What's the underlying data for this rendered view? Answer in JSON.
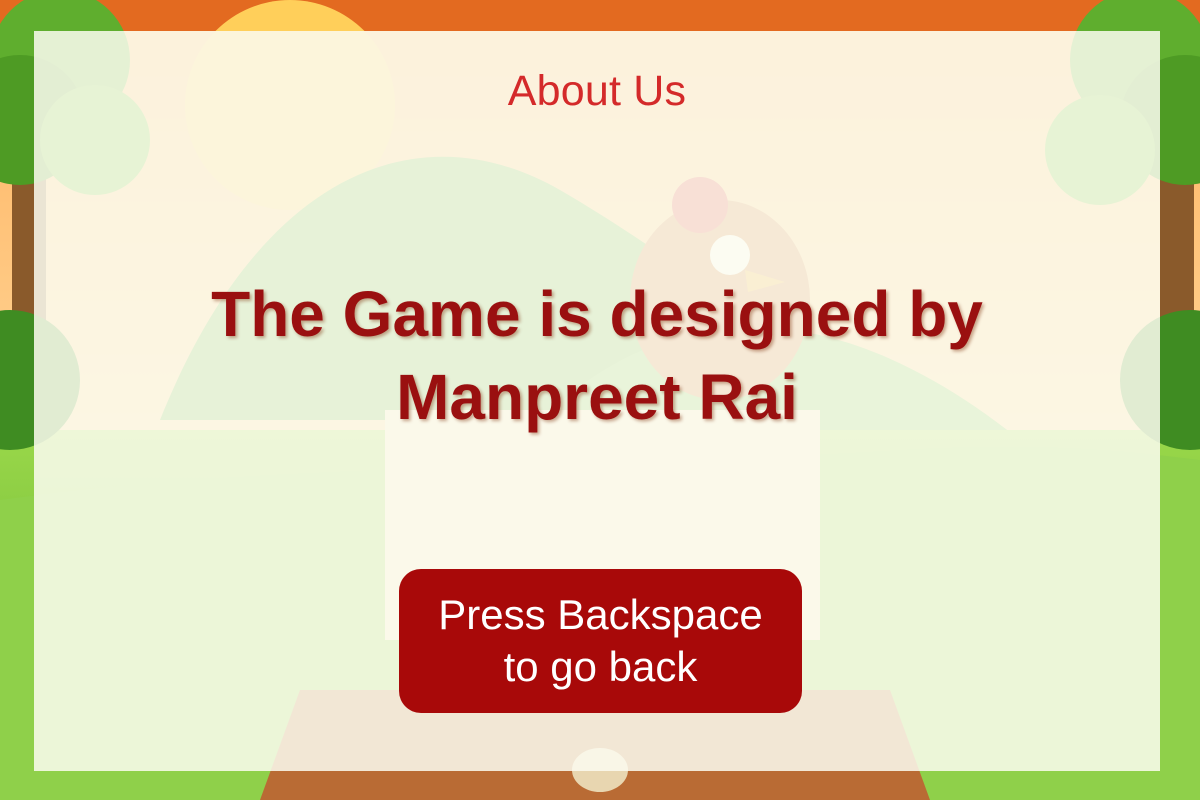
{
  "page": {
    "title": "About Us",
    "credit_line1": "The Game is designed by",
    "credit_line2": "Manpreet Rai"
  },
  "back_button": {
    "line1": "Press Backspace",
    "line2": "to go back"
  },
  "colors": {
    "title": "#d42a2a",
    "credit": "#9a1010",
    "button_bg": "#a80909",
    "button_text": "#ffffff",
    "border": "#e36a20"
  },
  "icons": [
    "sun-icon",
    "tree-icon",
    "hen-icon",
    "egg-icon"
  ]
}
